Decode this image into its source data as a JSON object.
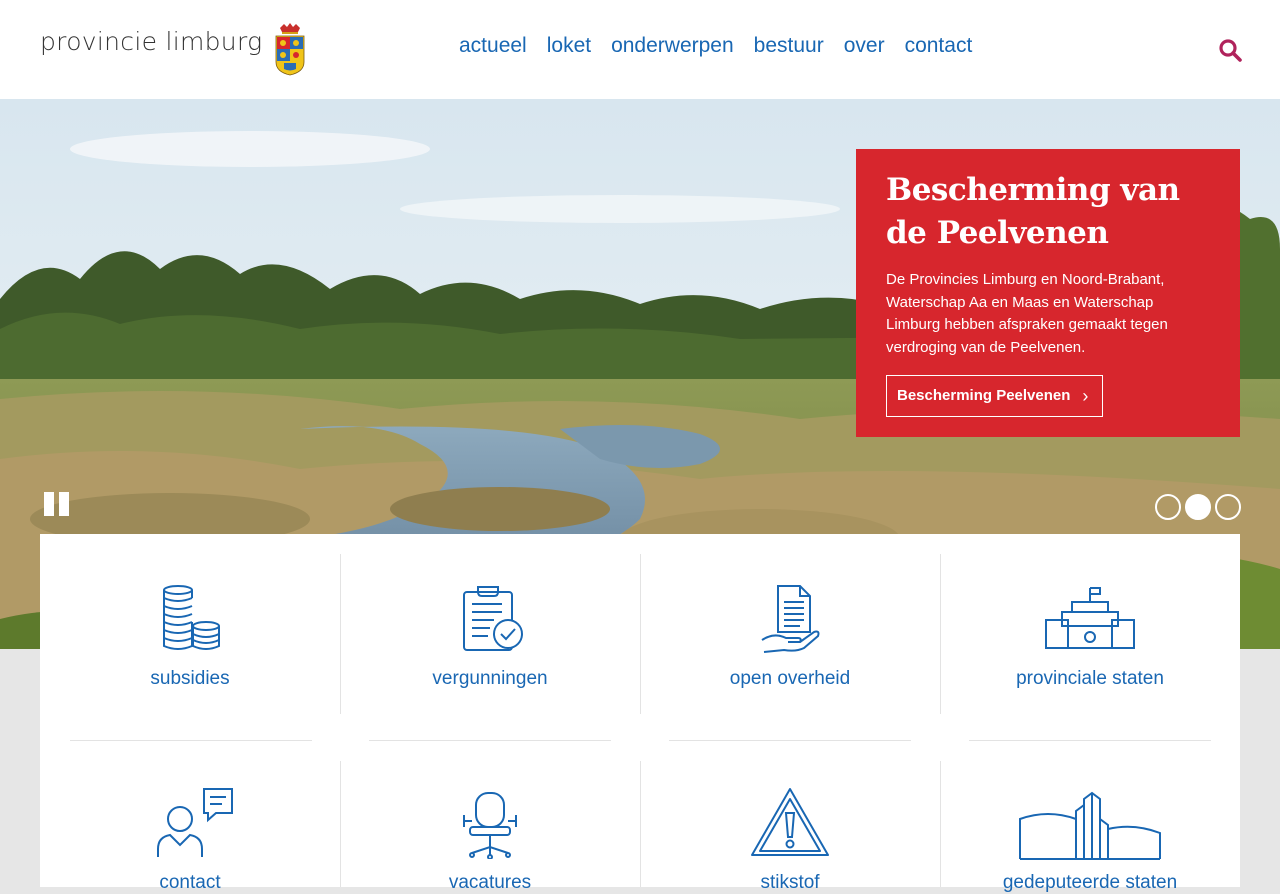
{
  "header": {
    "logo_text": "provincie limburg",
    "nav": [
      "actueel",
      "loket",
      "onderwerpen",
      "bestuur",
      "over",
      "contact"
    ]
  },
  "hero": {
    "title": "Bescherming van de Peelvenen",
    "text": "De Provincies Limburg en Noord-Brabant, Waterschap Aa en Maas en Waterschap Limburg hebben afspraken gemaakt tegen verdroging van de Peelvenen.",
    "button": "Bescherming Peelvenen",
    "slides": 3,
    "active_slide": 2
  },
  "tiles": [
    {
      "label": "subsidies",
      "icon": "coins-icon"
    },
    {
      "label": "vergunningen",
      "icon": "clipboard-check-icon"
    },
    {
      "label": "open overheid",
      "icon": "document-hand-icon"
    },
    {
      "label": "provinciale staten",
      "icon": "government-building-icon"
    },
    {
      "label": "contact",
      "icon": "person-speech-icon"
    },
    {
      "label": "vacatures",
      "icon": "office-chair-icon"
    },
    {
      "label": "stikstof",
      "icon": "warning-icon"
    },
    {
      "label": "gedeputeerde staten",
      "icon": "buildings-icon"
    }
  ],
  "colors": {
    "brand_blue": "#1967b3",
    "promo_red": "#d7262d",
    "search_icon": "#b0235c"
  }
}
